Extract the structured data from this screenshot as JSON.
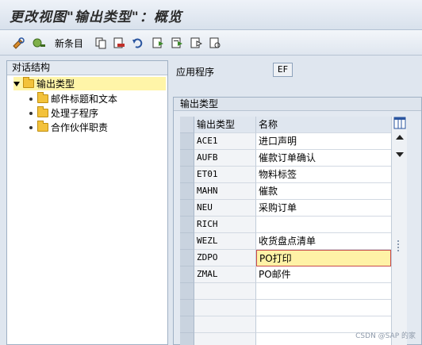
{
  "window": {
    "title": "更改视图\"输出类型\"：概览"
  },
  "toolbar": {
    "new_entries_label": "新条目",
    "icons": [
      "edit-glasses-icon",
      "display-change-icon",
      "copy-icon",
      "delete-icon",
      "undo-icon",
      "select-all-icon",
      "select-block-icon",
      "deselect-icon",
      "print-field-icon"
    ]
  },
  "dialog_structure": {
    "header": "对话结构",
    "root": "输出类型",
    "children": [
      "邮件标题和文本",
      "处理子程序",
      "合作伙伴职责"
    ]
  },
  "application": {
    "label": "应用程序",
    "value": "EF"
  },
  "output_types": {
    "header": "输出类型",
    "columns": [
      "输出类型",
      "名称"
    ],
    "rows": [
      {
        "key": "ACE1",
        "name": "进口声明"
      },
      {
        "key": "AUFB",
        "name": "催款订单确认"
      },
      {
        "key": "ET01",
        "name": "物料标签"
      },
      {
        "key": "MAHN",
        "name": "催款"
      },
      {
        "key": "NEU",
        "name": "采购订单"
      },
      {
        "key": "RICH",
        "name": ""
      },
      {
        "key": "WEZL",
        "name": "收货盘点清单"
      },
      {
        "key": "ZDPO",
        "name": "PO打印"
      },
      {
        "key": "ZMAL",
        "name": "PO邮件"
      }
    ]
  },
  "watermark": "CSDN @SAP 的家"
}
